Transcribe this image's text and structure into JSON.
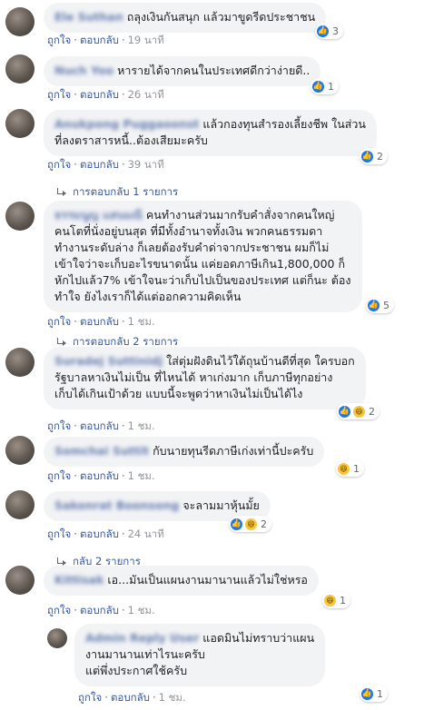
{
  "comments": [
    {
      "author": "Ele Suthan",
      "text": "ถลุงเงินกันสนุก แล้วมาขูดรีดประชาชน",
      "like_label": "ถูกใจ",
      "reply_label": "ตอบกลับ",
      "time": "19 นาที",
      "reaction_icons": [
        "like-icon"
      ],
      "reaction_count": "3"
    },
    {
      "author": "Nuch Yoo",
      "text": "หารายได้จากคนในประเทศดีกว่าง่ายดี..",
      "like_label": "ถูกใจ",
      "reply_label": "ตอบกลับ",
      "time": "26 นาที",
      "reaction_icons": [
        "like-icon"
      ],
      "reaction_count": "1"
    },
    {
      "author": "Anukpong Puggaoonst",
      "text": "แล้วกองทุนสำรองเลี้ยงชีพ ในส่วน\nที่ลงตราสารหนี้..ต้องเสียมะครับ",
      "like_label": "ถูกใจ",
      "reply_label": "ตอบกลับ",
      "time": "39 นาที",
      "reaction_icons": [
        "like-icon"
      ],
      "reaction_count": "2",
      "replies_text": "การตอบกลับ 1 รายการ"
    },
    {
      "author": "ธรรมนูญ แสนมณี",
      "text": "คนทำงานส่วนมากรับคำสั่งจากคนใหญ่\nคนโตที่นั่งอยู่บนสุด ที่มีทั้งอำนาจทั้งเงิน พวกคนธรรมดา\nทำงานระดับล่าง ก็เลยต้องรับคำด่าจากประชาชน ผมก็ไม่\nเข้าใจว่าจะเก็บอะไรขนาดนั้น แค่ยอดภาษีเกิน1,800,000 ก็\nหักไปแล้ว7% เข้าใจนะว่าเก็บไปเป็นของประเทศ แต่ก็นะ ต้อง\nทำใจ ยังไงเราก็ได้แต่ออกความคิดเห็น",
      "like_label": "ถูกใจ",
      "reply_label": "ตอบกลับ",
      "time": "1 ชม.",
      "reaction_icons": [
        "like-icon"
      ],
      "reaction_count": "5",
      "replies_text": "การตอบกลับ 2 รายการ"
    },
    {
      "author": "Suradej Suttinidj",
      "text": "ใส่ตุ่มฝังดินไว้ใต้ถุนบ้านดีที่สุด ใครบอก\nรัฐบาลหาเงินไม่เป็น ที่ไหนได้ หาเก่งมาก เก็บภาษีทุกอย่าง\nเก็บได้เกินเป้าด้วย แบบนี้จะพูดว่าหาเงินไม่เป็นได้ไง",
      "like_label": "ถูกใจ",
      "reply_label": "ตอบกลับ",
      "time": "1 ชม.",
      "reaction_icons": [
        "like-icon",
        "haha-icon"
      ],
      "reaction_count": "2"
    },
    {
      "author": "Somchai Suttit",
      "text": "กับนายทุนรีดภาษีเก่งเท่านี้ปะครับ",
      "like_label": "ถูกใจ",
      "reply_label": "ตอบกลับ",
      "time": "1 ชม.",
      "reaction_icons": [
        "haha-icon"
      ],
      "reaction_count": "1"
    },
    {
      "author": "Sakonrat Boonsong",
      "text": "จะลามมาหุ้นมั้ย",
      "like_label": "ถูกใจ",
      "reply_label": "ตอบกลับ",
      "time": "24 นาที",
      "reaction_icons": [
        "like-icon",
        "haha-icon"
      ],
      "reaction_count": "2",
      "replies_text": "กลับ 2 รายการ"
    },
    {
      "author": "Kittisak",
      "text": "เอ...มันเป็นแผนงานมานานแล้วไม่ใช่หรอ",
      "like_label": "ถูกใจ",
      "reply_label": "ตอบกลับ",
      "time": "1 ชม.",
      "reaction_icons": [
        "haha-icon"
      ],
      "reaction_count": "1"
    },
    {
      "author": "Admin Reply User",
      "text": "แอดมินไม่ทราบว่าแผน\nงานมานานเท่าไรนะครับ\nแต่พึ่งประกาศใช้ครับ",
      "like_label": "ถูกใจ",
      "reply_label": "ตอบกลับ",
      "time": "1 ชม.",
      "reaction_icons": [
        "like-icon"
      ],
      "reaction_count": "1"
    }
  ]
}
